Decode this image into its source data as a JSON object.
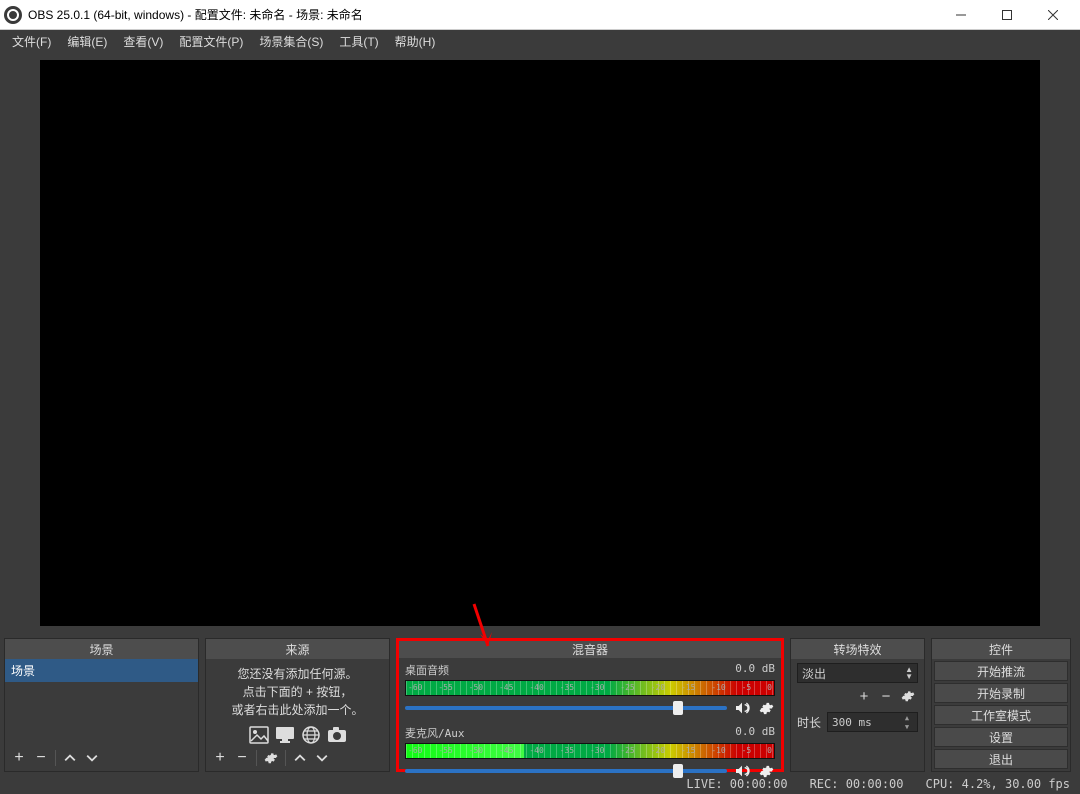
{
  "title": "OBS 25.0.1 (64-bit, windows) - 配置文件: 未命名 - 场景: 未命名",
  "menu": [
    "文件(F)",
    "编辑(E)",
    "查看(V)",
    "配置文件(P)",
    "场景集合(S)",
    "工具(T)",
    "帮助(H)"
  ],
  "docks": {
    "scenes": {
      "title": "场景",
      "items": [
        "场景"
      ]
    },
    "sources": {
      "title": "来源",
      "hint_lines": [
        "您还没有添加任何源。",
        "点击下面的 + 按钮，",
        "或者右击此处添加一个。"
      ]
    },
    "mixer": {
      "title": "混音器",
      "channels": [
        {
          "name": "桌面音频",
          "db": "0.0 dB",
          "fill_pct": 0
        },
        {
          "name": "麦克风/Aux",
          "db": "0.0 dB",
          "fill_pct": 32
        }
      ],
      "scale_labels": [
        "-60",
        "-55",
        "-50",
        "-45",
        "-40",
        "-35",
        "-30",
        "-25",
        "-20",
        "-15",
        "-10",
        "-5",
        "0"
      ]
    },
    "transitions": {
      "title": "转场特效",
      "selected": "淡出",
      "duration_label": "时长",
      "duration_value": "300 ms"
    },
    "controls": {
      "title": "控件",
      "buttons": [
        "开始推流",
        "开始录制",
        "工作室模式",
        "设置",
        "退出"
      ]
    }
  },
  "status": {
    "live": "LIVE: 00:00:00",
    "rec": "REC: 00:00:00",
    "cpu": "CPU: 4.2%, 30.00 fps"
  }
}
